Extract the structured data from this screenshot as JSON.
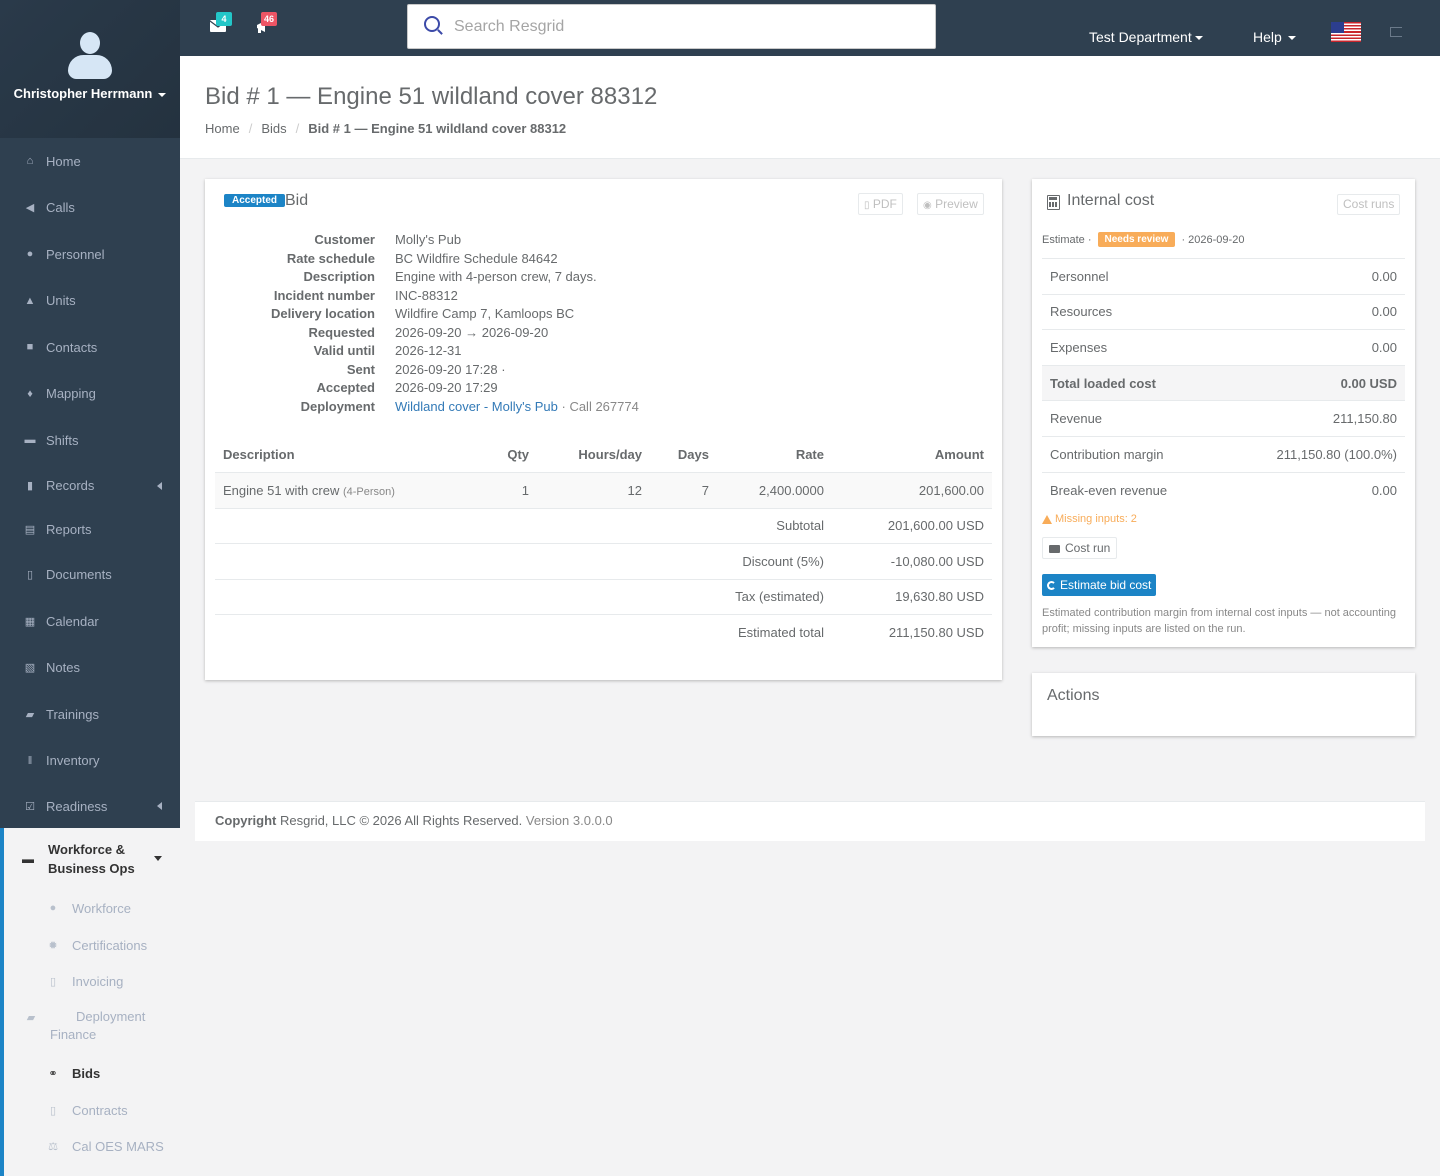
{
  "user": {
    "name": "Christopher Herrmann"
  },
  "nav": {
    "items": [
      {
        "label": "Home",
        "icon": "home-icon"
      },
      {
        "label": "Calls",
        "icon": "bullhorn-icon"
      },
      {
        "label": "Personnel",
        "icon": "user-icon"
      },
      {
        "label": "Units",
        "icon": "truck-icon"
      },
      {
        "label": "Contacts",
        "icon": "address-book-icon"
      },
      {
        "label": "Mapping",
        "icon": "map-marker-icon"
      },
      {
        "label": "Shifts",
        "icon": "briefcase-icon"
      },
      {
        "label": "Records",
        "icon": "file-icon"
      },
      {
        "label": "Reports",
        "icon": "report-icon"
      },
      {
        "label": "Documents",
        "icon": "document-icon"
      },
      {
        "label": "Calendar",
        "icon": "calendar-icon"
      },
      {
        "label": "Notes",
        "icon": "notes-icon"
      },
      {
        "label": "Trainings",
        "icon": "book-icon"
      },
      {
        "label": "Inventory",
        "icon": "barcode-icon"
      },
      {
        "label": "Readiness",
        "icon": "check-square-icon"
      }
    ],
    "group": {
      "label": "Workforce & Business Ops",
      "items": [
        {
          "label": "Workforce",
          "icon": "users-icon"
        },
        {
          "label": "Certifications",
          "icon": "certificate-icon"
        },
        {
          "label": "Invoicing",
          "icon": "invoice-icon"
        },
        {
          "label": "Deployment Finance",
          "icon": "truck-icon"
        },
        {
          "label": "Bids",
          "icon": "handshake-icon"
        },
        {
          "label": "Contracts",
          "icon": "contract-icon"
        },
        {
          "label": "Cal OES MARS",
          "icon": "scale-icon"
        }
      ]
    }
  },
  "topbar": {
    "messages_count": "4",
    "calls_count": "46",
    "search_placeholder": "Search Resgrid",
    "department": "Test Department",
    "help": "Help",
    "colors": {
      "messages_badge": "#23c6c8",
      "calls_badge": "#ed5565"
    }
  },
  "page": {
    "title": "Bid # 1 — Engine 51 wildland cover 88312",
    "breadcrumb": [
      "Home",
      "Bids",
      "Bid # 1 — Engine 51 wildland cover 88312"
    ]
  },
  "bid": {
    "status": "Accepted",
    "heading": "Bid",
    "pdf_label": "PDF",
    "preview_label": "Preview",
    "details": [
      {
        "label": "Customer",
        "value": "Molly's Pub"
      },
      {
        "label": "Rate schedule",
        "value": "BC Wildfire Schedule 84642"
      },
      {
        "label": "Description",
        "value": "Engine with 4-person crew, 7 days."
      },
      {
        "label": "Incident number",
        "value": "INC-88312"
      },
      {
        "label": "Delivery location",
        "value": "Wildfire Camp 7, Kamloops BC"
      },
      {
        "label": "Requested",
        "value": "2026-09-20 → 2026-09-20"
      },
      {
        "label": "Valid until",
        "value": "2026-12-31"
      },
      {
        "label": "Sent",
        "value": "2026-09-20 17:28 ·"
      },
      {
        "label": "Accepted",
        "value": "2026-09-20 17:29"
      }
    ],
    "deployment": {
      "label": "Deployment",
      "link": "Wildland cover - Molly's Pub",
      "suffix": "· Call 267774"
    },
    "columns": {
      "description": "Description",
      "qty": "Qty",
      "hours": "Hours/day",
      "days": "Days",
      "rate": "Rate",
      "amount": "Amount"
    },
    "line_item": {
      "description": "Engine 51 with crew",
      "note": "(4-Person)",
      "qty": "1",
      "hours": "12",
      "days": "7",
      "rate": "2,400.0000",
      "amount": "201,600.00"
    },
    "totals": [
      {
        "label": "Subtotal",
        "value": "201,600.00 USD"
      },
      {
        "label": "Discount (5%)",
        "value": "-10,080.00 USD"
      },
      {
        "label": "Tax (estimated)",
        "value": "19,630.80 USD"
      },
      {
        "label": "Estimated total",
        "value": "211,150.80 USD"
      }
    ]
  },
  "cost": {
    "title": "Internal cost",
    "runs_button": "Cost runs",
    "estimate_label": "Estimate ·",
    "review_badge": "Needs review",
    "date": "· 2026-09-20",
    "rows": [
      {
        "label": "Personnel",
        "value": "0.00"
      },
      {
        "label": "Resources",
        "value": "0.00"
      },
      {
        "label": "Expenses",
        "value": "0.00"
      },
      {
        "label": "Total loaded cost",
        "value": "0.00 USD"
      },
      {
        "label": "Revenue",
        "value": "211,150.80"
      },
      {
        "label": "Contribution margin",
        "value": "211,150.80 (100.0%)"
      },
      {
        "label": "Break-even revenue",
        "value": "0.00"
      }
    ],
    "missing": "Missing inputs: 2",
    "cost_run_button": "Cost run",
    "estimate_button": "Estimate bid cost",
    "note": "Estimated contribution margin from internal cost inputs — not accounting profit; missing inputs are listed on the run."
  },
  "actions": {
    "title": "Actions"
  },
  "footer": {
    "copyright": "Copyright",
    "text": "Resgrid, LLC © 2026 All Rights Reserved.",
    "version": "Version 3.0.0.0"
  }
}
